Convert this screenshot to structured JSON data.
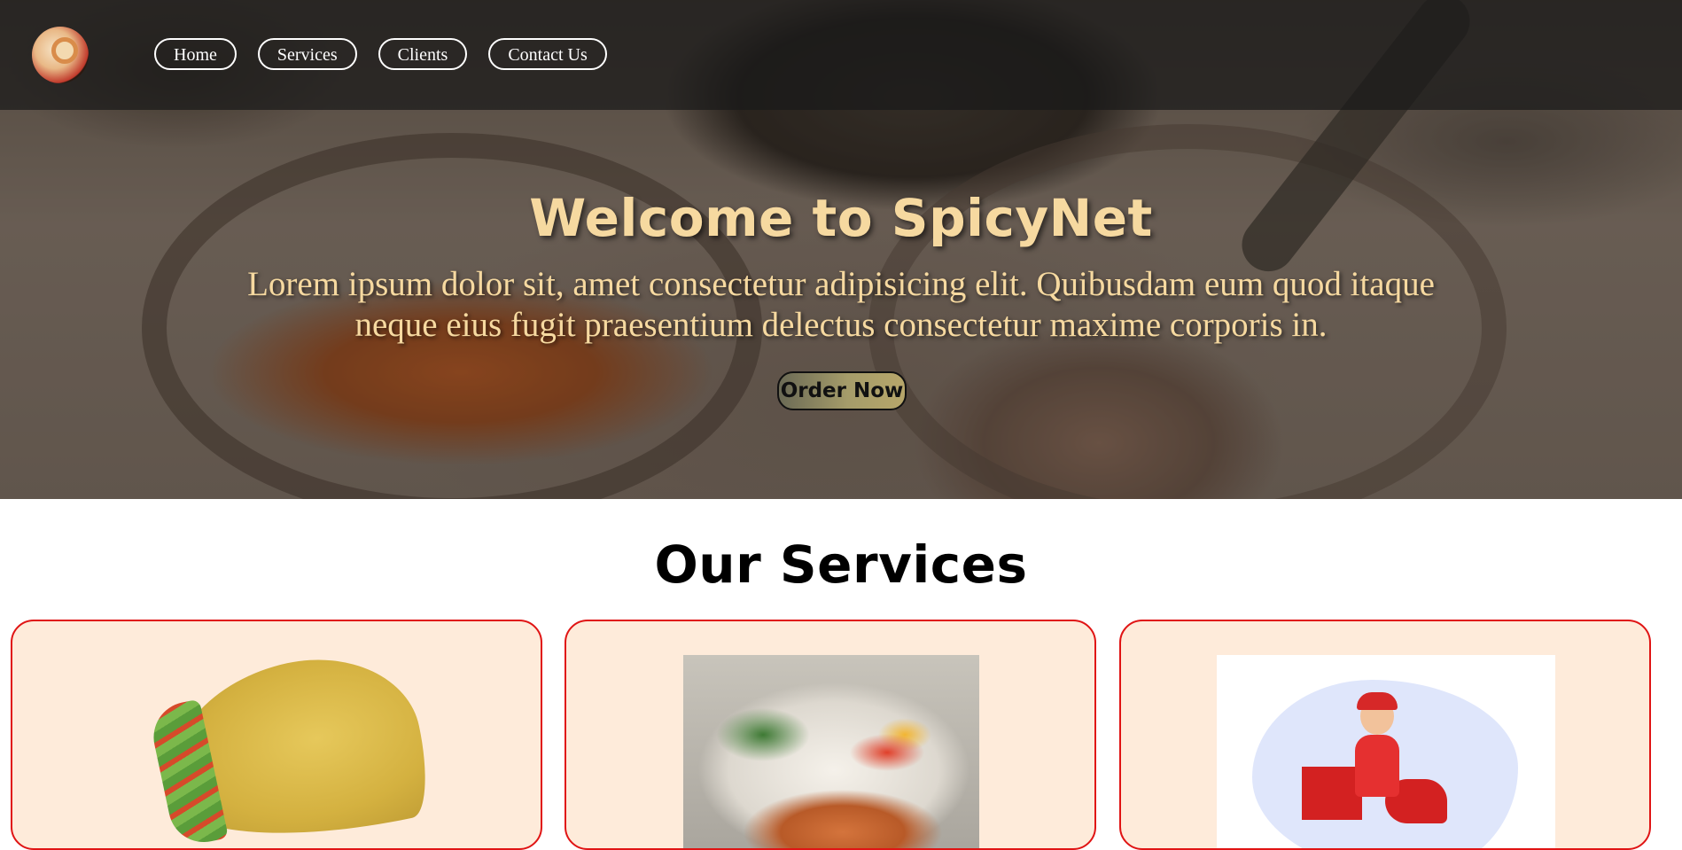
{
  "header": {
    "logo_icon": "spice-bowl-logo-icon",
    "nav": [
      "Home",
      "Services",
      "Clients",
      "Contact Us"
    ]
  },
  "hero": {
    "title": "Welcome to SpicyNet",
    "text": "Lorem ipsum dolor sit, amet consectetur adipisicing elit. Quibusdam eum quod itaque neque eius fugit praesentium delectus consectetur maxime corporis in.",
    "cta": "Order Now"
  },
  "services": {
    "title": "Our Services",
    "cards": [
      {
        "image": "taco-image"
      },
      {
        "image": "grilled-salmon-salad-image"
      },
      {
        "image": "delivery-rider-illustration"
      }
    ]
  },
  "colors": {
    "hero_text": "#f6d9a0",
    "card_bg": "#feebda",
    "card_border": "#e01414",
    "topbar": "rgba(25,25,25,0.72)"
  }
}
